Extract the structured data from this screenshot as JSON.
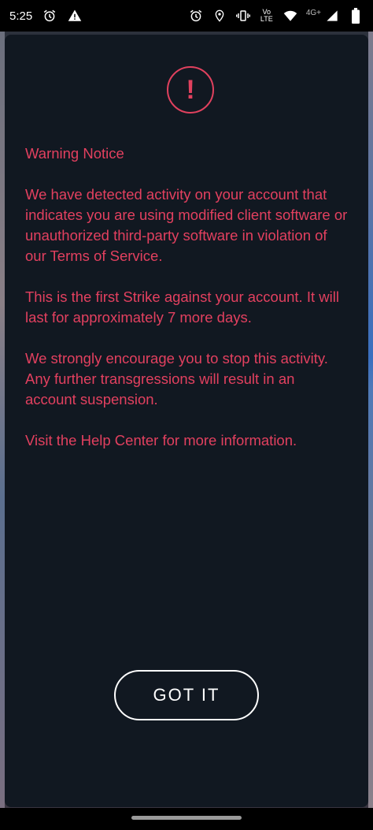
{
  "status_bar": {
    "time": "5:25",
    "volte_top": "Vo",
    "volte_bottom": "LTE",
    "network": "4G+"
  },
  "dialog": {
    "icon_glyph": "!",
    "title": "Warning Notice",
    "paragraph1_pre": "We have detected activity on your account that indicates you are using modified client software or unauthorized third-party software in violation of our ",
    "terms_link": "Terms of Service",
    "paragraph1_post": ".",
    "paragraph2": "This is the first Strike against your account. It will last for approximately 7 more days.",
    "paragraph3": "We strongly encourage you to stop this activity. Any further transgressions will result in an account suspension.",
    "help_link": "Visit the Help Center",
    "help_post": " for more information.",
    "button_label": "GOT IT"
  },
  "colors": {
    "accent": "#e2405f",
    "dialog_bg": "#111821",
    "button_border": "#ffffff"
  },
  "icons": [
    "alarm-icon",
    "warning-icon",
    "location-icon",
    "vibrate-icon",
    "wifi-icon",
    "signal-icon",
    "battery-icon"
  ]
}
